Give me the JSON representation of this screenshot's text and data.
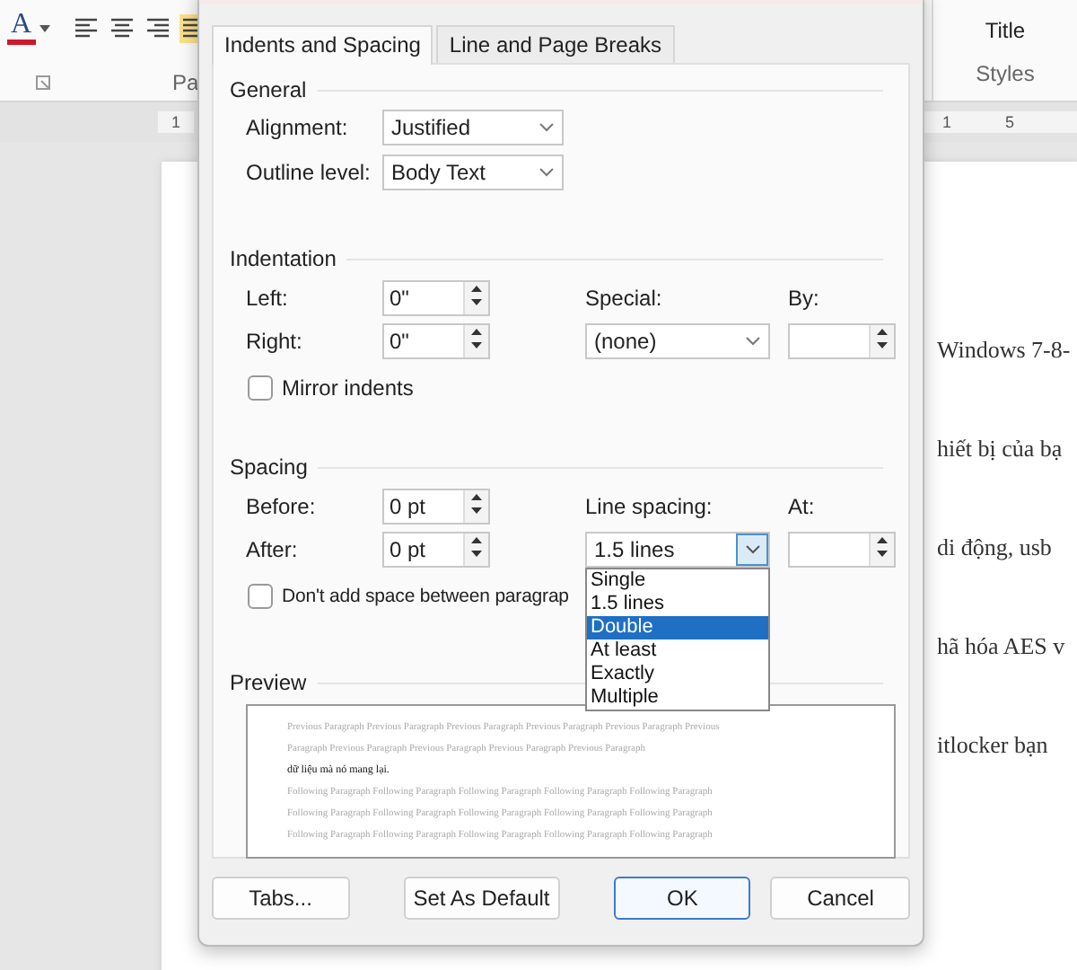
{
  "ribbon": {
    "font_color_letter": "A",
    "group_label": "Pa",
    "style_name": "Title",
    "styles_label": "Styles"
  },
  "ruler": {
    "left_mark": "1",
    "right_marks": [
      "1",
      "5"
    ]
  },
  "document_lines": [
    "Windows 7-8-",
    "hiết bị của bạ",
    "di động, usb",
    "hã hóa AES v",
    "itlocker bạn"
  ],
  "dialog": {
    "tabs": [
      {
        "label": "Indents and Spacing",
        "selected": true
      },
      {
        "label": "Line and Page Breaks",
        "selected": false
      }
    ],
    "general": {
      "title": "General",
      "fields": [
        {
          "label": "Alignment:",
          "value": "Justified"
        },
        {
          "label": "Outline level:",
          "value": "Body Text"
        }
      ]
    },
    "indentation": {
      "title": "Indentation",
      "left": {
        "label": "Left:",
        "value": "0\""
      },
      "right": {
        "label": "Right:",
        "value": "0\""
      },
      "special": {
        "label": "Special:",
        "value": "(none)"
      },
      "by": {
        "label": "By:"
      },
      "mirror": {
        "label": "Mirror indents",
        "checked": false
      }
    },
    "spacing": {
      "title": "Spacing",
      "before": {
        "label": "Before:",
        "value": "0 pt"
      },
      "after": {
        "label": "After:",
        "value": "0 pt"
      },
      "line_spacing": {
        "label": "Line spacing:",
        "value": "1.5 lines",
        "open": true
      },
      "at": {
        "label": "At:"
      },
      "dont_add": {
        "label": "Don't add space between paragrap",
        "checked": false
      }
    },
    "line_spacing_options": [
      {
        "label": "Single",
        "selected": false
      },
      {
        "label": "1.5 lines",
        "selected": false
      },
      {
        "label": "Double",
        "selected": true
      },
      {
        "label": "At least",
        "selected": false
      },
      {
        "label": "Exactly",
        "selected": false
      },
      {
        "label": "Multiple",
        "selected": false
      }
    ],
    "preview": {
      "title": "Preview",
      "previous_lines": [
        "Previous Paragraph Previous Paragraph Previous Paragraph Previous Paragraph Previous Paragraph Previous",
        "Paragraph Previous Paragraph Previous Paragraph Previous Paragraph Previous Paragraph"
      ],
      "current": "dữ liệu mà nó mang lại.",
      "following_lines": [
        "Following Paragraph Following Paragraph Following Paragraph Following Paragraph Following Paragraph",
        "Following Paragraph Following Paragraph Following Paragraph Following Paragraph Following Paragraph",
        "Following Paragraph Following Paragraph Following Paragraph Following Paragraph Following Paragraph"
      ]
    },
    "buttons": [
      {
        "label": "Tabs...",
        "default": false
      },
      {
        "label": "Set As Default",
        "default": false
      },
      {
        "label": "OK",
        "default": true
      },
      {
        "label": "Cancel",
        "default": false
      }
    ]
  }
}
